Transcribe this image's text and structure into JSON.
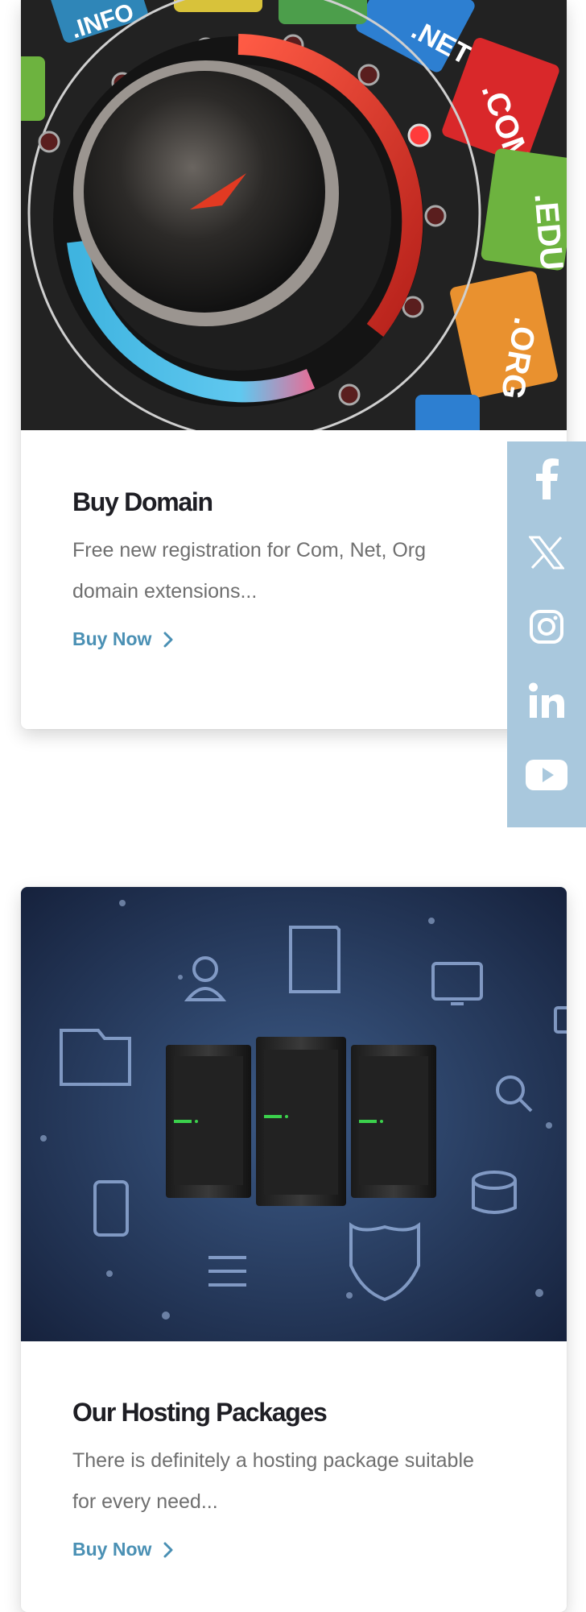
{
  "cards": [
    {
      "title": "Buy Domain",
      "description": "Free new registration for Com, Net, Org domain extensions...",
      "cta_label": "Buy Now",
      "image_alt": "domain-dial-image"
    },
    {
      "title": "Our Hosting Packages",
      "description": "There is definitely a hosting package suitable for every need...",
      "cta_label": "Buy Now",
      "image_alt": "hosting-servers-image"
    }
  ],
  "social_bar": {
    "items": [
      "facebook-icon",
      "x-twitter-icon",
      "instagram-icon",
      "linkedin-icon",
      "youtube-icon"
    ],
    "background": "#a9c8dd"
  },
  "dial_tlds": [
    ".NET",
    ".COM",
    ".EDU",
    ".ORG",
    ".INFO"
  ],
  "colors": {
    "accent": "#4a90b4",
    "title": "#1e1e24",
    "text": "#6f6f6f"
  }
}
